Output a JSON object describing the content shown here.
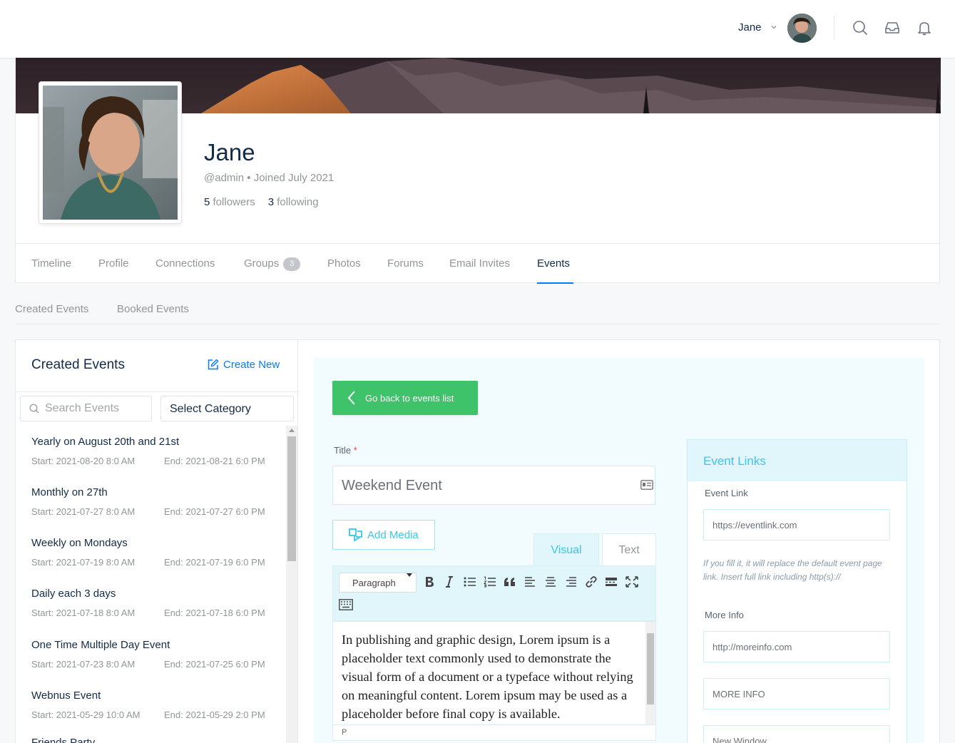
{
  "topbar": {
    "username": "Jane"
  },
  "profile": {
    "name": "Jane",
    "handle": "@admin",
    "joined": "Joined July 2021",
    "followers_count": "5",
    "followers_label": "followers",
    "following_count": "3",
    "following_label": "following"
  },
  "nav": {
    "tabs": [
      {
        "label": "Timeline"
      },
      {
        "label": "Profile"
      },
      {
        "label": "Connections"
      },
      {
        "label": "Groups",
        "badge": "3"
      },
      {
        "label": "Photos"
      },
      {
        "label": "Forums"
      },
      {
        "label": "Email Invites"
      },
      {
        "label": "Events",
        "active": true
      }
    ]
  },
  "subtabs": [
    "Created Events",
    "Booked Events"
  ],
  "events_panel": {
    "title": "Created Events",
    "create_new": "Create New",
    "search_placeholder": "Search Events",
    "category_select": "Select Category",
    "events": [
      {
        "name": "Yearly on August 20th and 21st",
        "start": "Start: 2021-08-20 8:0 AM",
        "end": "End: 2021-08-21 6:0 PM"
      },
      {
        "name": "Monthly on 27th",
        "start": "Start: 2021-07-27 8:0 AM",
        "end": "End: 2021-07-27 6:0 PM"
      },
      {
        "name": "Weekly on Mondays",
        "start": "Start: 2021-07-19 8:0 AM",
        "end": "End: 2021-07-19 6:0 PM"
      },
      {
        "name": "Daily each 3 days",
        "start": "Start: 2021-07-18 8:0 AM",
        "end": "End: 2021-07-18 6:0 PM"
      },
      {
        "name": "One Time Multiple Day Event",
        "start": "Start: 2021-07-23 8:0 AM",
        "end": "End: 2021-07-25 6:0 PM"
      },
      {
        "name": "Webnus Event",
        "start": "Start: 2021-05-29 10:0 AM",
        "end": "End: 2021-05-29 2:0 PM"
      },
      {
        "name": "Friends Party",
        "start": "",
        "end": ""
      }
    ]
  },
  "editor": {
    "back_button": "Go back to events list",
    "title_label": "Title",
    "required_mark": "*",
    "title_value": "Weekend Event",
    "add_media": "Add Media",
    "tab_visual": "Visual",
    "tab_text": "Text",
    "paragraph_select": "Paragraph",
    "content": "In publishing and graphic design, Lorem ipsum is a placeholder text commonly used to demonstrate the visual form of a document or a typeface without relying on meaningful content. Lorem ipsum may be used as a placeholder before final copy is available.",
    "status_path": "P"
  },
  "event_links": {
    "title": "Event Links",
    "event_link_label": "Event Link",
    "event_link_value": "https://eventlink.com",
    "help_text": "If you fill it, it will replace the default event page link. Insert full link including http(s)://",
    "more_info_label": "More Info",
    "more_info_value": "http://moreinfo.com",
    "more_info_text": "MORE INFO",
    "new_window": "New Window"
  },
  "colors": {
    "accent": "#007cff",
    "green": "#3ec26a",
    "cyan": "#39c7e9"
  }
}
